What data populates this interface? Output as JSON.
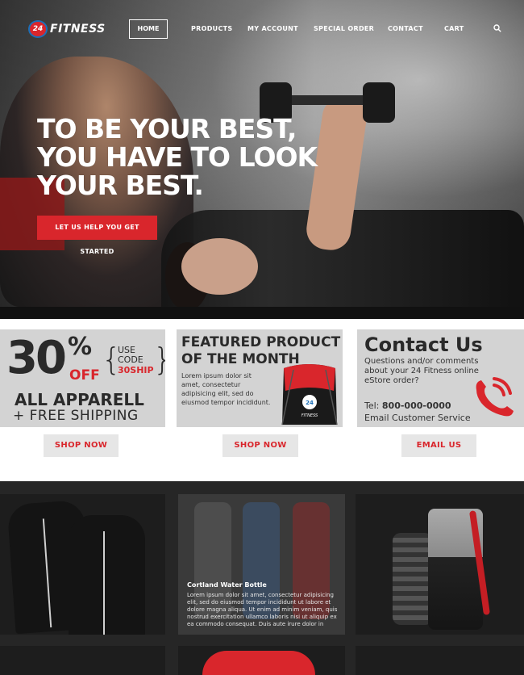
{
  "brand": {
    "logo_badge": "24",
    "logo_text": "FITNESS",
    "accent": "#d9262c"
  },
  "nav": {
    "items": [
      "HOME",
      "PRODUCTS",
      "MY ACCOUNT",
      "SPECIAL ORDER",
      "CONTACT",
      "CART"
    ],
    "active": "HOME",
    "search_icon": "search-icon"
  },
  "hero": {
    "headline_lines": [
      "TO BE YOUR BEST,",
      "YOU HAVE TO LOOK",
      "YOUR BEST."
    ],
    "cta_label": "LET US HELP YOU GET STARTED"
  },
  "promos": {
    "apparel": {
      "percent_number": "30",
      "percent_sign": "%",
      "off": "OFF",
      "use_code_lines": [
        "USE",
        "CODE"
      ],
      "code": "30SHIP",
      "line1": "ALL APPARELL",
      "line2": "+ FREE SHIPPING",
      "button": "SHOP NOW"
    },
    "featured": {
      "title_lines": [
        "FEATURED PRODUCT",
        "OF THE MONTH"
      ],
      "description": "Lorem ipsum dolor sit amet, consectetur adipisicing elit, sed do eiusmod tempor incididunt.",
      "button": "SHOP NOW"
    },
    "contact": {
      "title": "Contact Us",
      "description": "Questions and/or comments about your 24 Fitness online eStore order?",
      "tel_label": "Tel:",
      "tel_number": "800-000-0000",
      "email_text": "Email Customer Service",
      "button": "EMAIL US"
    }
  },
  "products": {
    "featured_card": {
      "title": "Cortland Water Bottle",
      "description": "Lorem ipsum dolor sit amet, consectetur adipisicing elit, sed do eiusmod tempor incididunt ut labore et dolore magna aliqua. Ut enim ad minim veniam, quis nostrud exercitation ullamco laboris nisi ut aliquip ex ea commodo consequat. Duis aute irure dolor in"
    }
  }
}
